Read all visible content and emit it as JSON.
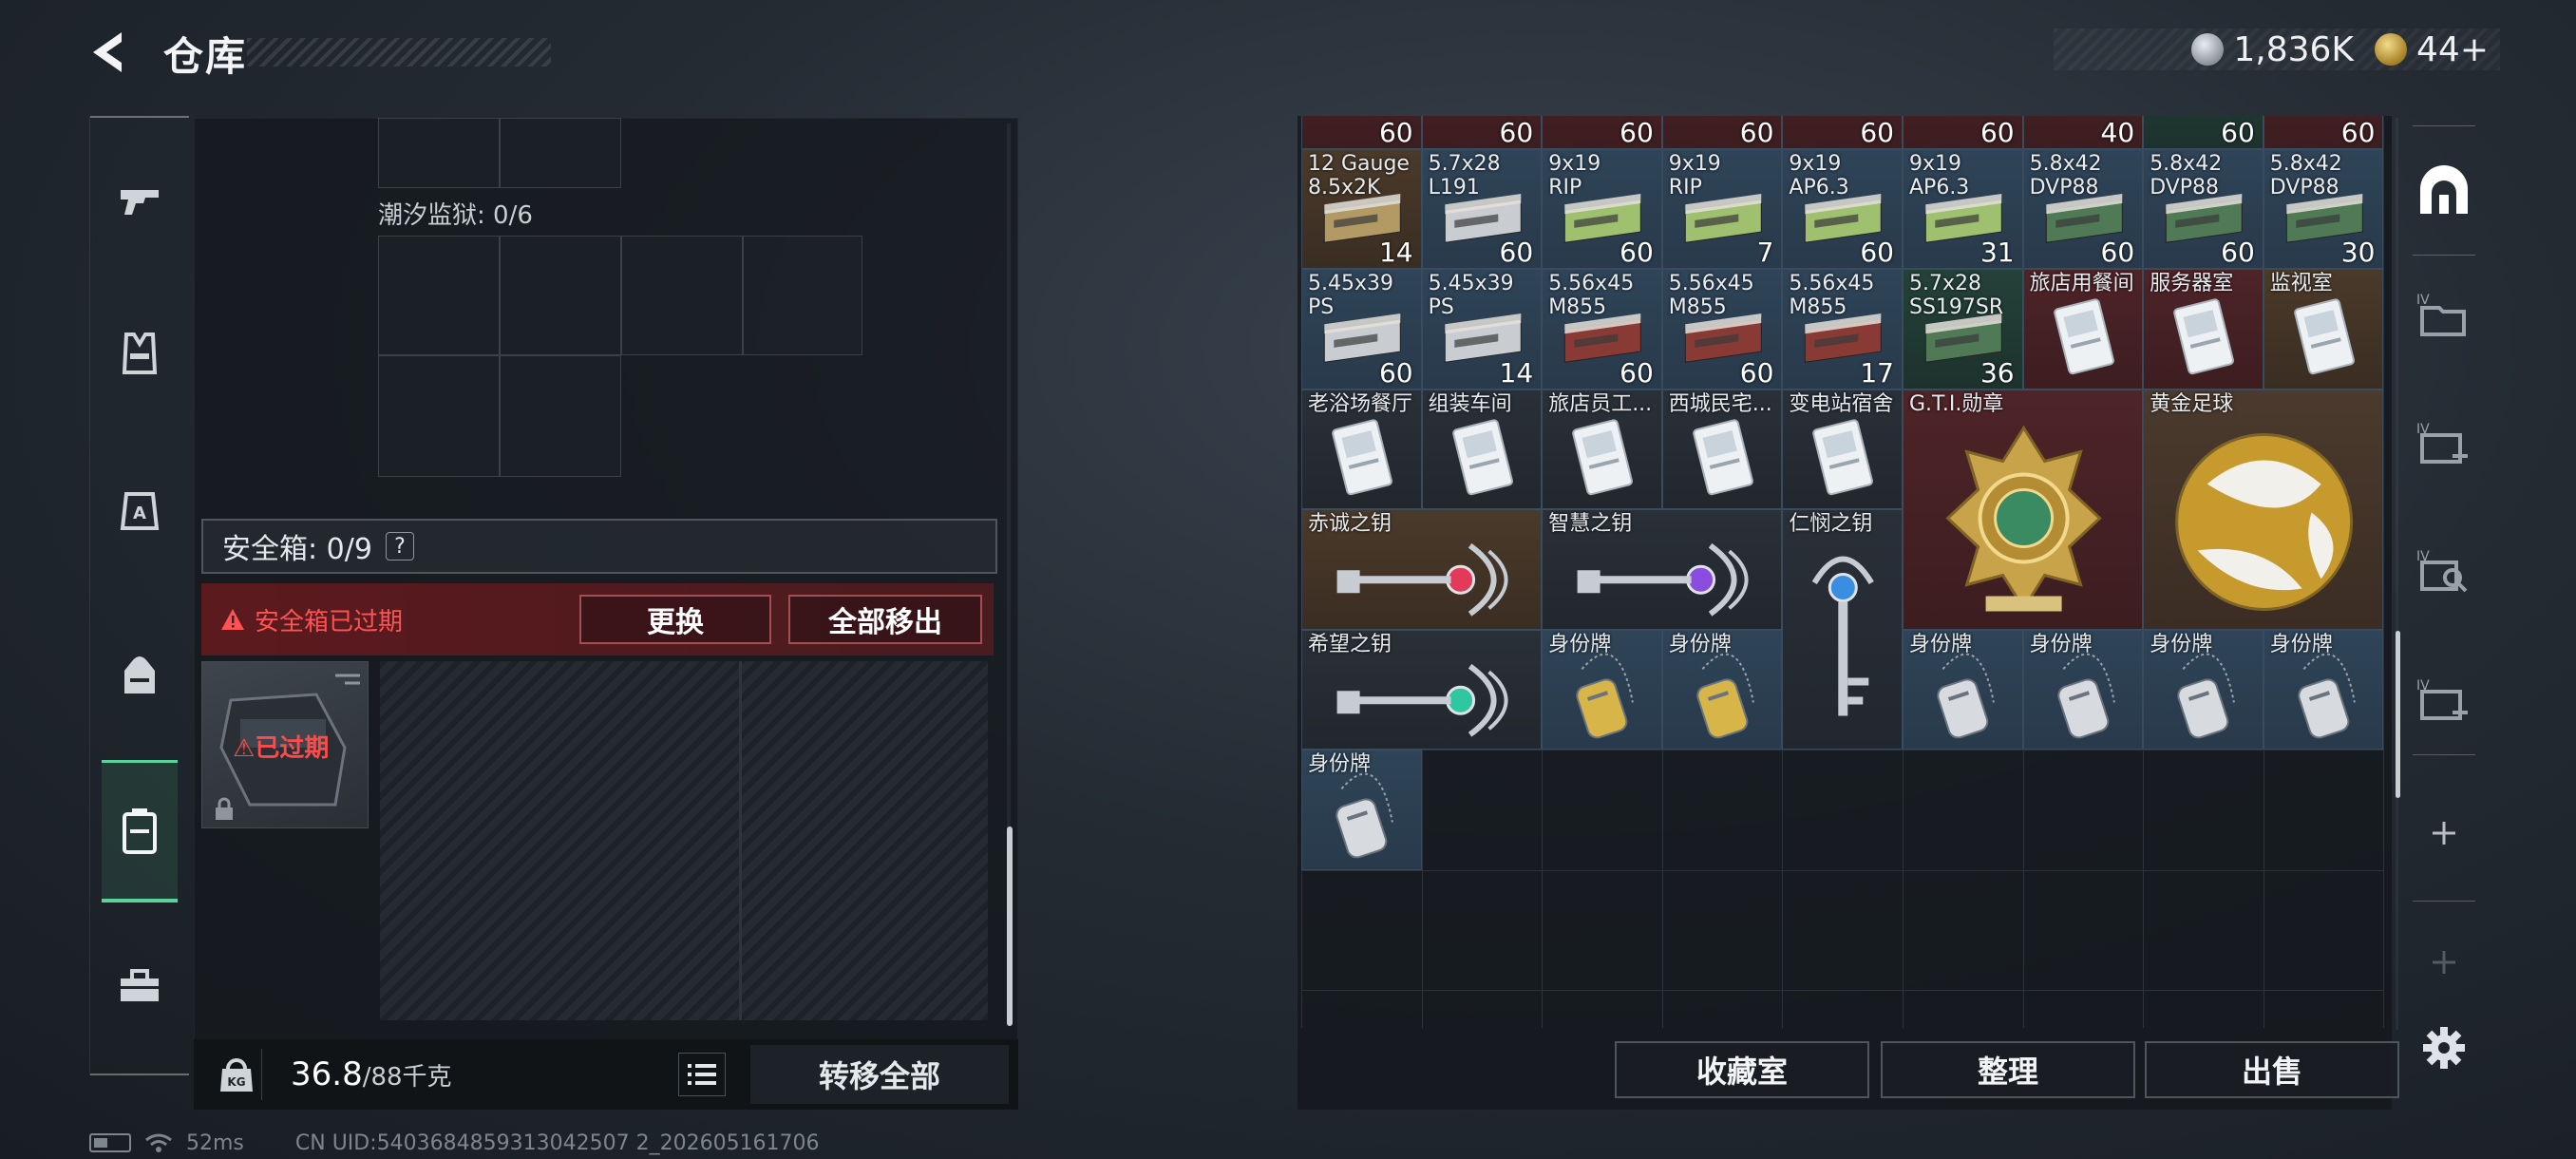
{
  "header": {
    "title": "仓库",
    "currency": [
      {
        "icon": "silver-coin-icon",
        "value": "1,836K"
      },
      {
        "icon": "gold-coin-icon",
        "value": "44+"
      }
    ]
  },
  "left_rail": {
    "items": [
      {
        "name": "weapon-icon"
      },
      {
        "name": "armor-vest-icon"
      },
      {
        "name": "chest-rig-icon"
      },
      {
        "name": "backpack-icon"
      },
      {
        "name": "safebox-icon",
        "active": true
      },
      {
        "name": "toolbox-icon"
      }
    ]
  },
  "storage": {
    "prison_label": "潮汐监狱: 0/6",
    "safebox_label": "安全箱: 0/9",
    "help": "?",
    "expired_warning": "安全箱已过期",
    "replace_button": "更换",
    "move_all_out_button": "全部移出",
    "box_expired_label": "已过期",
    "weight_value": "36.8",
    "weight_max": "/88千克",
    "transfer_all_button": "转移全部"
  },
  "inventory": {
    "top_row_qty": [
      "60",
      "60",
      "60",
      "60",
      "60",
      "60",
      "40",
      "60",
      "60"
    ],
    "items": [
      {
        "name": "12 Gauge\n8.5x2K",
        "qty": "14",
        "kind": "ammo-tan",
        "color": "brown"
      },
      {
        "name": "5.7x28\nL191",
        "qty": "60",
        "kind": "ammo-white",
        "color": "blue"
      },
      {
        "name": "9x19\nRIP",
        "qty": "60",
        "kind": "ammo-green",
        "color": "blue"
      },
      {
        "name": "9x19\nRIP",
        "qty": "7",
        "kind": "ammo-green",
        "color": "blue"
      },
      {
        "name": "9x19\nAP6.3",
        "qty": "60",
        "kind": "ammo-green",
        "color": "blue"
      },
      {
        "name": "9x19\nAP6.3",
        "qty": "31",
        "kind": "ammo-green",
        "color": "blue"
      },
      {
        "name": "5.8x42\nDVP88",
        "qty": "60",
        "kind": "ammo-dkgreen",
        "color": "blue"
      },
      {
        "name": "5.8x42\nDVP88",
        "qty": "60",
        "kind": "ammo-dkgreen",
        "color": "blue"
      },
      {
        "name": "5.8x42\nDVP88",
        "qty": "30",
        "kind": "ammo-dkgreen",
        "color": "blue"
      },
      {
        "name": "5.45x39\nPS",
        "qty": "60",
        "kind": "ammo-white",
        "color": "blue"
      },
      {
        "name": "5.45x39\nPS",
        "qty": "14",
        "kind": "ammo-white",
        "color": "blue"
      },
      {
        "name": "5.56x45\nM855",
        "qty": "60",
        "kind": "ammo-red",
        "color": "blue"
      },
      {
        "name": "5.56x45\nM855",
        "qty": "60",
        "kind": "ammo-red",
        "color": "blue"
      },
      {
        "name": "5.56x45\nM855",
        "qty": "17",
        "kind": "ammo-red",
        "color": "blue"
      },
      {
        "name": "5.7x28\nSS197SR",
        "qty": "36",
        "kind": "ammo-dkgreen",
        "color": "green"
      },
      {
        "name": "旅店用餐间",
        "qty": "",
        "kind": "keycard",
        "color": "red"
      },
      {
        "name": "服务器室",
        "qty": "",
        "kind": "keycard",
        "color": "red"
      },
      {
        "name": "监视室",
        "qty": "",
        "kind": "keycard",
        "color": "brown"
      },
      {
        "name": "老浴场餐厅",
        "qty": "",
        "kind": "keycard",
        "color": "dark"
      },
      {
        "name": "组装车间",
        "qty": "",
        "kind": "keycard",
        "color": "dark"
      },
      {
        "name": "旅店员工...",
        "qty": "",
        "kind": "keycard",
        "color": "dark"
      },
      {
        "name": "西城民宅...",
        "qty": "",
        "kind": "keycard",
        "color": "dark"
      },
      {
        "name": "变电站宿舍",
        "qty": "",
        "kind": "keycard",
        "color": "dark"
      },
      {
        "name": "G.T.I.勋章",
        "qty": "",
        "kind": "medal",
        "color": "red"
      },
      {
        "name": "黄金足球",
        "qty": "",
        "kind": "gold-ball",
        "color": "gold"
      },
      {
        "name": "赤诚之钥",
        "qty": "",
        "kind": "key-red",
        "color": "brown"
      },
      {
        "name": "智慧之钥",
        "qty": "",
        "kind": "key-purple",
        "color": "dark"
      },
      {
        "name": "仁悯之钥",
        "qty": "",
        "kind": "key-blue",
        "color": "dark"
      },
      {
        "name": "希望之钥",
        "qty": "",
        "kind": "key-green",
        "color": "dark"
      },
      {
        "name": "身份牌",
        "qty": "",
        "kind": "dogtag-gold",
        "color": "blue"
      },
      {
        "name": "身份牌",
        "qty": "",
        "kind": "dogtag-gold",
        "color": "blue"
      },
      {
        "name": "身份牌",
        "qty": "",
        "kind": "dogtag-silver",
        "color": "blue"
      },
      {
        "name": "身份牌",
        "qty": "",
        "kind": "dogtag-silver",
        "color": "blue"
      },
      {
        "name": "身份牌",
        "qty": "",
        "kind": "dogtag-silver",
        "color": "blue"
      },
      {
        "name": "身份牌",
        "qty": "",
        "kind": "dogtag-silver",
        "color": "blue"
      },
      {
        "name": "身份牌",
        "qty": "",
        "kind": "dogtag-silver",
        "color": "blue"
      }
    ],
    "buttons": {
      "collection": "收藏室",
      "sort": "整理",
      "sell": "出售"
    }
  },
  "right_rail": {
    "items": [
      "safehouse-icon",
      "folder-iv-icon",
      "medkit-iv-add-icon",
      "search-iv-icon",
      "medkit-iv-add-icon-2",
      "add-icon",
      "add-icon-disabled",
      "settings-icon"
    ]
  },
  "status": {
    "ping": "52ms",
    "uid": "CN UID:5403684859313042507 2_202605161706"
  },
  "colors": {
    "accent": "#5ad29a",
    "warning": "#ff5353"
  }
}
